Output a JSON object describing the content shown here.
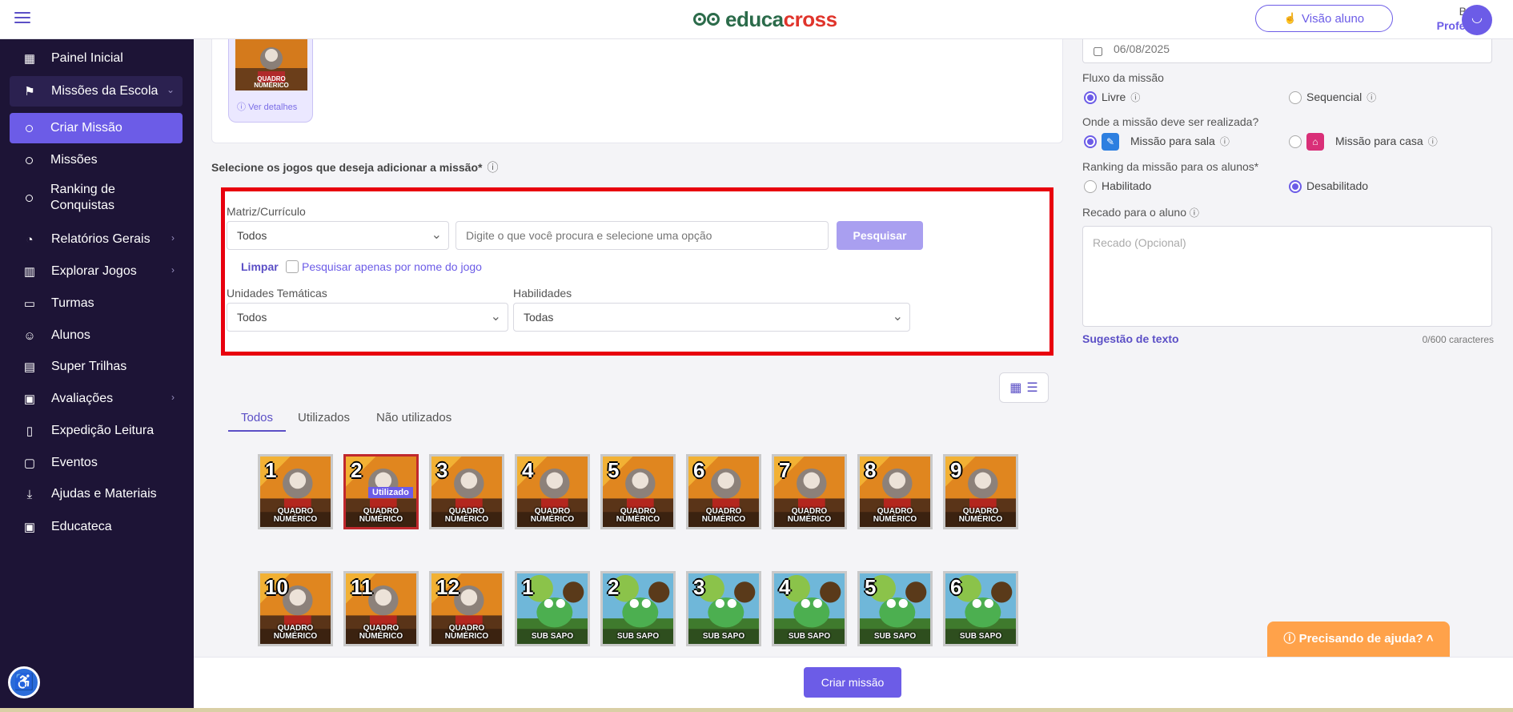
{
  "header": {
    "logo_part1": "educa",
    "logo_part2": "cross",
    "visao_aluno": "Visão aluno",
    "user_name": "Bruno",
    "user_role": "Professor"
  },
  "sidebar": {
    "items": [
      {
        "label": "Painel Inicial",
        "icon": "grid-icon"
      },
      {
        "label": "Missões da Escola",
        "icon": "flag-icon"
      },
      {
        "label": "Criar Missão"
      },
      {
        "label": "Missões"
      },
      {
        "label": "Ranking de Conquistas"
      },
      {
        "label": "Relatórios Gerais",
        "icon": "chart-pie-icon"
      },
      {
        "label": "Explorar Jogos",
        "icon": "map-icon"
      },
      {
        "label": "Turmas",
        "icon": "briefcase-icon"
      },
      {
        "label": "Alunos",
        "icon": "users-icon"
      },
      {
        "label": "Super Trilhas",
        "icon": "book-open-icon"
      },
      {
        "label": "Avaliações",
        "icon": "quiz-icon"
      },
      {
        "label": "Expedição Leitura",
        "icon": "book-icon"
      },
      {
        "label": "Eventos",
        "icon": "calendar-icon"
      },
      {
        "label": "Ajudas e Materiais",
        "icon": "download-icon"
      },
      {
        "label": "Educateca",
        "icon": "video-icon"
      }
    ]
  },
  "selected_game": {
    "title_line1": "QUADRO",
    "title_line2": "NUMÉRICO",
    "ver_detalhes": "Ver detalhes"
  },
  "games_section": {
    "label": "Selecione os jogos que deseja adicionar a missão*"
  },
  "filters": {
    "matriz_label": "Matriz/Currículo",
    "matriz_value": "Todos",
    "search_placeholder": "Digite o que você procura e selecione uma opção",
    "pesquisar": "Pesquisar",
    "limpar": "Limpar",
    "checkbox_label": "Pesquisar apenas por nome do jogo",
    "unidades_label": "Unidades Temáticas",
    "unidades_value": "Todos",
    "habilidades_label": "Habilidades",
    "habilidades_value": "Todas"
  },
  "tabs": [
    "Todos",
    "Utilizados",
    "Não utilizados"
  ],
  "games": [
    {
      "num": "1",
      "line1": "QUADRO",
      "line2": "NUMÉRICO",
      "used": false,
      "kind": "quadro"
    },
    {
      "num": "2",
      "line1": "QUADRO",
      "line2": "NUMÉRICO",
      "used": true,
      "kind": "quadro"
    },
    {
      "num": "3",
      "line1": "QUADRO",
      "line2": "NUMÉRICO",
      "used": false,
      "kind": "quadro"
    },
    {
      "num": "4",
      "line1": "QUADRO",
      "line2": "NUMÉRICO",
      "used": false,
      "kind": "quadro"
    },
    {
      "num": "5",
      "line1": "QUADRO",
      "line2": "NUMÉRICO",
      "used": false,
      "kind": "quadro"
    },
    {
      "num": "6",
      "line1": "QUADRO",
      "line2": "NUMÉRICO",
      "used": false,
      "kind": "quadro"
    },
    {
      "num": "7",
      "line1": "QUADRO",
      "line2": "NUMÉRICO",
      "used": false,
      "kind": "quadro"
    },
    {
      "num": "8",
      "line1": "QUADRO",
      "line2": "NUMÉRICO",
      "used": false,
      "kind": "quadro"
    },
    {
      "num": "9",
      "line1": "QUADRO",
      "line2": "NUMÉRICO",
      "used": false,
      "kind": "quadro"
    },
    {
      "num": "10",
      "line1": "QUADRO",
      "line2": "NUMÉRICO",
      "used": false,
      "kind": "quadro"
    },
    {
      "num": "11",
      "line1": "QUADRO",
      "line2": "NUMÉRICO",
      "used": false,
      "kind": "quadro"
    },
    {
      "num": "12",
      "line1": "QUADRO",
      "line2": "NUMÉRICO",
      "used": false,
      "kind": "quadro"
    },
    {
      "num": "1",
      "line1": "SUB SAPO",
      "line2": "",
      "used": false,
      "kind": "sapo"
    },
    {
      "num": "2",
      "line1": "SUB SAPO",
      "line2": "",
      "used": false,
      "kind": "sapo"
    },
    {
      "num": "3",
      "line1": "SUB SAPO",
      "line2": "",
      "used": false,
      "kind": "sapo"
    },
    {
      "num": "4",
      "line1": "SUB SAPO",
      "line2": "",
      "used": false,
      "kind": "sapo"
    },
    {
      "num": "5",
      "line1": "SUB SAPO",
      "line2": "",
      "used": false,
      "kind": "sapo"
    },
    {
      "num": "6",
      "line1": "SUB SAPO",
      "line2": "",
      "used": false,
      "kind": "sapo"
    }
  ],
  "used_badge": "Utilizado",
  "right_panel": {
    "date": "06/08/2025",
    "fluxo_label": "Fluxo da missão",
    "fluxo_livre": "Livre",
    "fluxo_sequencial": "Sequencial",
    "onde_label": "Onde a missão deve ser realizada?",
    "missao_sala": "Missão para sala",
    "missao_casa": "Missão para casa",
    "ranking_label": "Ranking da missão para os alunos*",
    "habilitado": "Habilitado",
    "desabilitado": "Desabilitado",
    "recado_label": "Recado para o aluno",
    "recado_placeholder": "Recado (Opcional)",
    "sugestao": "Sugestão de texto",
    "charcount": "0/600 caracteres"
  },
  "help_button": "Precisando de ajuda?",
  "criar_missao": "Criar missão",
  "colors": {
    "accent": "#6c5ce7",
    "sidebar_bg": "#1d1436",
    "highlight_border": "#e8000e",
    "help": "#ffa24a"
  }
}
